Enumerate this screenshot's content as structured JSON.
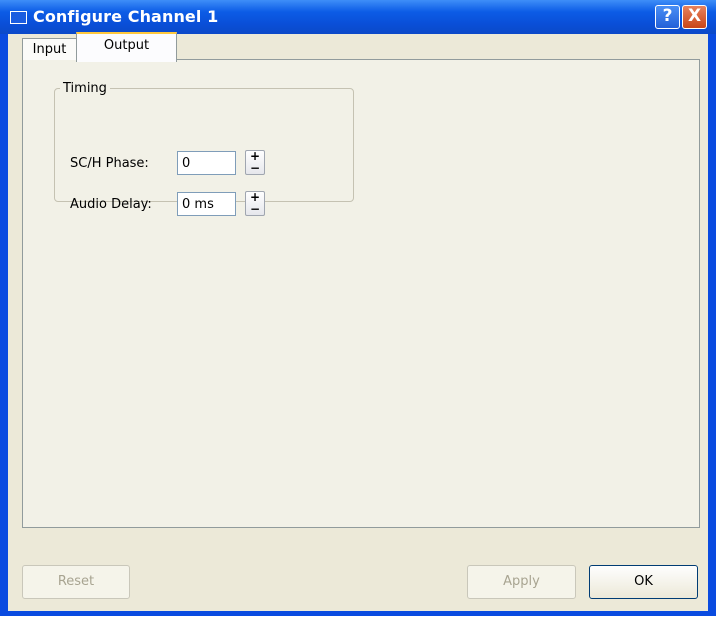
{
  "window": {
    "title": "Configure Channel 1",
    "help_glyph": "?",
    "close_glyph": "X"
  },
  "tabs": [
    {
      "label": "Input",
      "selected": false
    },
    {
      "label": "Output",
      "selected": true
    }
  ],
  "timing": {
    "group_label": "Timing",
    "sch_phase": {
      "label": "SC/H Phase:",
      "value": "0"
    },
    "audio_delay": {
      "label": "Audio Delay:",
      "value": "0 ms"
    },
    "spin_up": "+",
    "spin_down": "−"
  },
  "buttons": {
    "reset": "Reset",
    "apply": "Apply",
    "ok": "OK"
  },
  "colors": {
    "title_bar": "#0a4be0",
    "dialog_face": "#ece9d8",
    "tab_accent": "#ffc83c"
  }
}
